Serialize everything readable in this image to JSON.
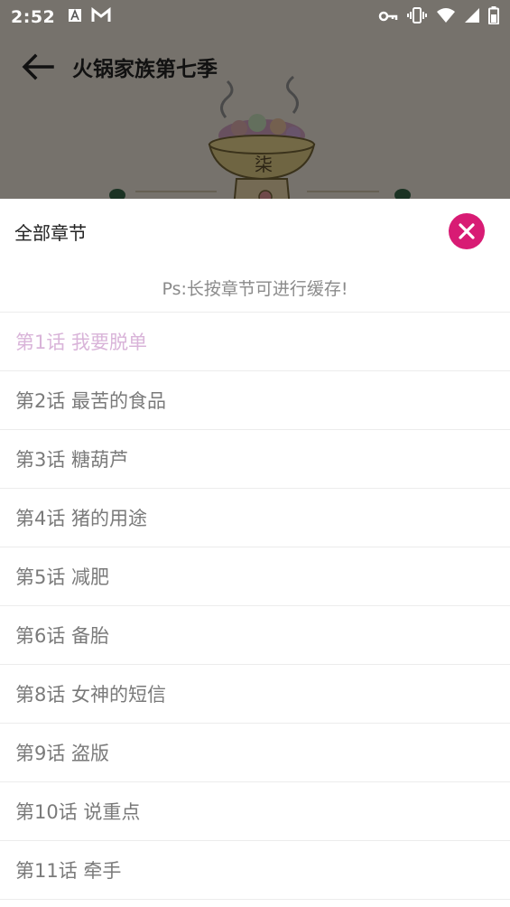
{
  "status_bar": {
    "time": "2:52",
    "left_icons": [
      "font-notification-icon",
      "gmail-icon"
    ],
    "right_icons": [
      "vpn-key-icon",
      "vibrate-icon",
      "wifi-icon",
      "signal-icon",
      "battery-icon"
    ]
  },
  "toolbar": {
    "title": "火锅家族第七季",
    "back_icon": "arrow-left-icon"
  },
  "cover": {
    "logo_text": "柒"
  },
  "sheet": {
    "title": "全部章节",
    "close_icon": "close-icon",
    "hint": "Ps:长按章节可进行缓存!",
    "accent_color": "#d81b74",
    "active_color": "#d9b4d9",
    "chapters": [
      {
        "label": "第1话 我要脱单",
        "active": true
      },
      {
        "label": "第2话 最苦的食品",
        "active": false
      },
      {
        "label": "第3话 糖葫芦",
        "active": false
      },
      {
        "label": "第4话 猪的用途",
        "active": false
      },
      {
        "label": "第5话 减肥",
        "active": false
      },
      {
        "label": "第6话 备胎",
        "active": false
      },
      {
        "label": "第8话 女神的短信",
        "active": false
      },
      {
        "label": "第9话 盗版",
        "active": false
      },
      {
        "label": "第10话 说重点",
        "active": false
      },
      {
        "label": "第11话 牵手",
        "active": false
      }
    ]
  }
}
